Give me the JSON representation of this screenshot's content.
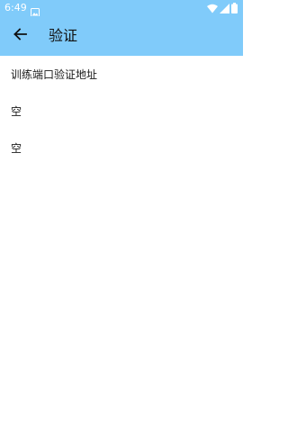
{
  "status_bar": {
    "time": "6:49",
    "icons": [
      "image-notification-icon",
      "wifi-icon",
      "signal-icon",
      "battery-icon"
    ]
  },
  "app_bar": {
    "back_icon": "arrow-back-icon",
    "title": "验证"
  },
  "list": {
    "items": [
      {
        "label": "训练端口验证地址"
      },
      {
        "label": "空"
      },
      {
        "label": "空"
      }
    ]
  },
  "colors": {
    "accent": "#80cbfa",
    "background": "#ffffff",
    "text": "#1a1a1a"
  }
}
